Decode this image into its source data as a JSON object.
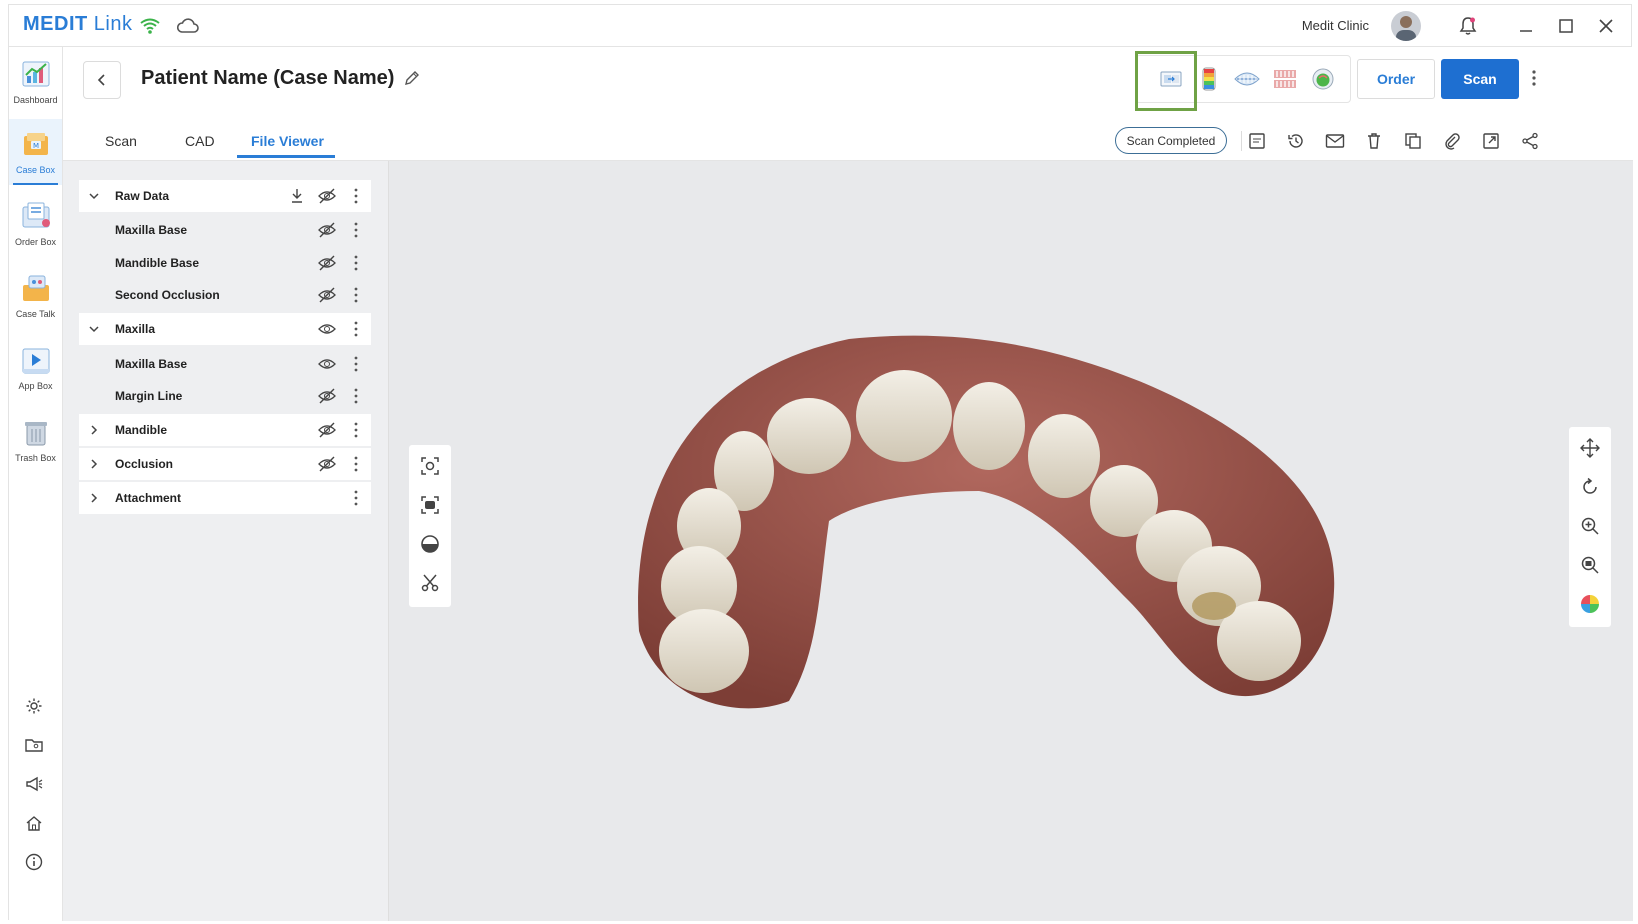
{
  "app": {
    "brand_part1": "MEDIT",
    "brand_part2": "Link",
    "clinic_name": "Medit Clinic",
    "accent_color": "#2a7dd6",
    "highlight_color": "#6fa245"
  },
  "titlebar_icons": [
    "wifi-icon",
    "cloud-icon",
    "bell-icon",
    "minimize-icon",
    "maximize-icon",
    "close-icon"
  ],
  "sidebar": {
    "items": [
      {
        "label": "Dashboard",
        "icon": "dashboard-icon"
      },
      {
        "label": "Case Box",
        "icon": "case-box-icon",
        "active": true
      },
      {
        "label": "Order Box",
        "icon": "order-box-icon"
      },
      {
        "label": "Case Talk",
        "icon": "case-talk-icon"
      },
      {
        "label": "App Box",
        "icon": "app-box-icon"
      },
      {
        "label": "Trash Box",
        "icon": "trash-box-icon"
      }
    ],
    "bottom_icons": [
      "settings-icon",
      "folder-icon",
      "megaphone-icon",
      "home-icon",
      "info-icon"
    ]
  },
  "header": {
    "title": "Patient Name (Case Name)",
    "order_label": "Order",
    "scan_label": "Scan",
    "status_label": "Scan Completed",
    "tabs": [
      {
        "label": "Scan"
      },
      {
        "label": "CAD"
      },
      {
        "label": "File Viewer",
        "active": true
      }
    ]
  },
  "tree": {
    "rows": [
      {
        "label": "Raw Data",
        "type": "group",
        "expanded": true,
        "eye": "hidden",
        "download": true
      },
      {
        "label": "Maxilla Base",
        "type": "child",
        "eye": "hidden"
      },
      {
        "label": "Mandible Base",
        "type": "child",
        "eye": "hidden"
      },
      {
        "label": "Second Occlusion",
        "type": "child",
        "eye": "hidden"
      },
      {
        "label": "Maxilla",
        "type": "group",
        "expanded": true,
        "eye": "visible"
      },
      {
        "label": "Maxilla Base",
        "type": "child",
        "eye": "visible"
      },
      {
        "label": "Margin Line",
        "type": "child",
        "eye": "hidden"
      },
      {
        "label": "Mandible",
        "type": "group",
        "expanded": false,
        "eye": "hidden"
      },
      {
        "label": "Occlusion",
        "type": "group",
        "expanded": false,
        "eye": "hidden"
      },
      {
        "label": "Attachment",
        "type": "group",
        "expanded": false,
        "eye": "none"
      }
    ]
  }
}
